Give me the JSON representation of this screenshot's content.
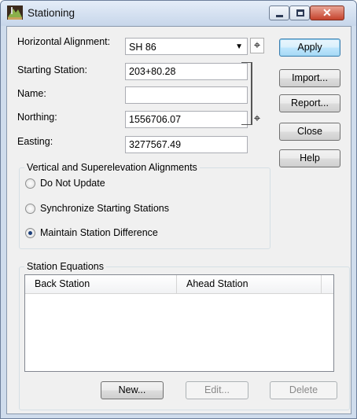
{
  "window": {
    "title": "Stationing",
    "app_icon": "stationing-icon",
    "caption_buttons": [
      "minimize-icon",
      "maximize-icon",
      "close-icon"
    ],
    "close_glyph": "✕"
  },
  "form": {
    "horizontal_alignment_label": "Horizontal Alignment:",
    "horizontal_alignment_value": "SH 86",
    "starting_station_label": "Starting Station:",
    "starting_station_value": "203+80.28",
    "name_label": "Name:",
    "name_value": "",
    "northing_label": "Northing:",
    "northing_value": "1556706.07",
    "easting_label": "Easting:",
    "easting_value": "3277567.49",
    "pick_glyph": "⌖",
    "dropdown_glyph": "▼"
  },
  "buttons": {
    "apply": "Apply",
    "import": "Import...",
    "report": "Report...",
    "close": "Close",
    "help": "Help"
  },
  "vertical_group": {
    "title": "Vertical and Superelevation Alignments",
    "options": [
      {
        "label": "Do Not Update",
        "checked": false
      },
      {
        "label": "Synchronize Starting Stations",
        "checked": false
      },
      {
        "label": "Maintain Station Difference",
        "checked": true
      }
    ]
  },
  "equations_group": {
    "title": "Station Equations",
    "columns": [
      "Back Station",
      "Ahead Station"
    ],
    "rows": [],
    "new_button": "New...",
    "edit_button": "Edit...",
    "delete_button": "Delete",
    "edit_enabled": false,
    "delete_enabled": false
  },
  "colors": {
    "title_bar": "#c7d6ea",
    "dialog_background": "#f0f0f0",
    "default_button_border": "#3c7fb1",
    "close_button": "#c5432d"
  }
}
